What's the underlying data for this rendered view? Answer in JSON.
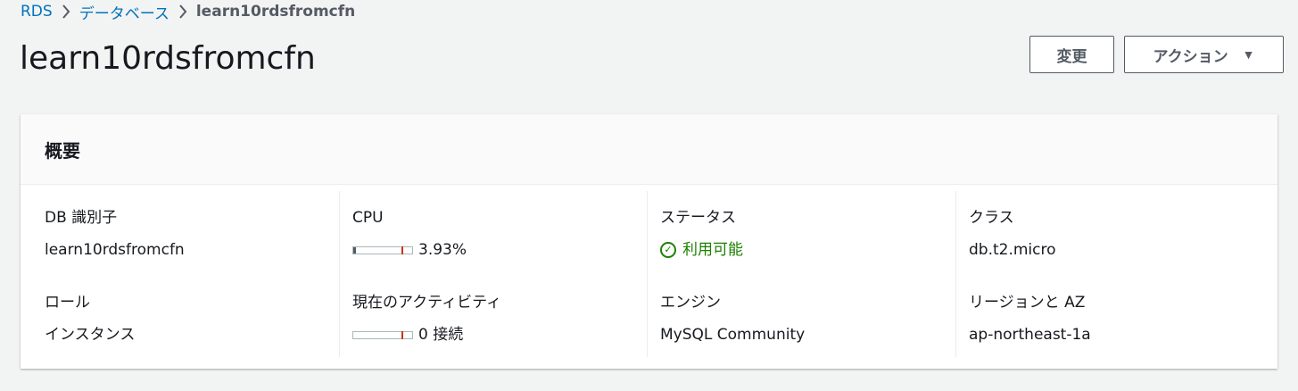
{
  "breadcrumb": {
    "items": [
      "RDS",
      "データベース"
    ],
    "current": "learn10rdsfromcfn"
  },
  "page_title": "learn10rdsfromcfn",
  "actions": {
    "modify_label": "変更",
    "action_label": "アクション"
  },
  "summary": {
    "heading": "概要",
    "db_identifier_label": "DB 識別子",
    "db_identifier_value": "learn10rdsfromcfn",
    "role_label": "ロール",
    "role_value": "インスタンス",
    "cpu_label": "CPU",
    "cpu_value": "3.93%",
    "cpu_fraction": 0.0393,
    "activity_label": "現在のアクティビティ",
    "activity_value": "0 接続",
    "activity_fraction": 0,
    "status_label": "ステータス",
    "status_value": "利用可能",
    "engine_label": "エンジン",
    "engine_value": "MySQL Community",
    "class_label": "クラス",
    "class_value": "db.t2.micro",
    "region_label": "リージョンと AZ",
    "region_value": "ap-northeast-1a"
  },
  "colors": {
    "link": "#0073bb",
    "success": "#1d8102",
    "threshold": "#d13212"
  },
  "icons": {
    "breadcrumb_separator": "chevron-right-icon",
    "dropdown": "caret-down-icon",
    "status": "check-circle-icon"
  }
}
